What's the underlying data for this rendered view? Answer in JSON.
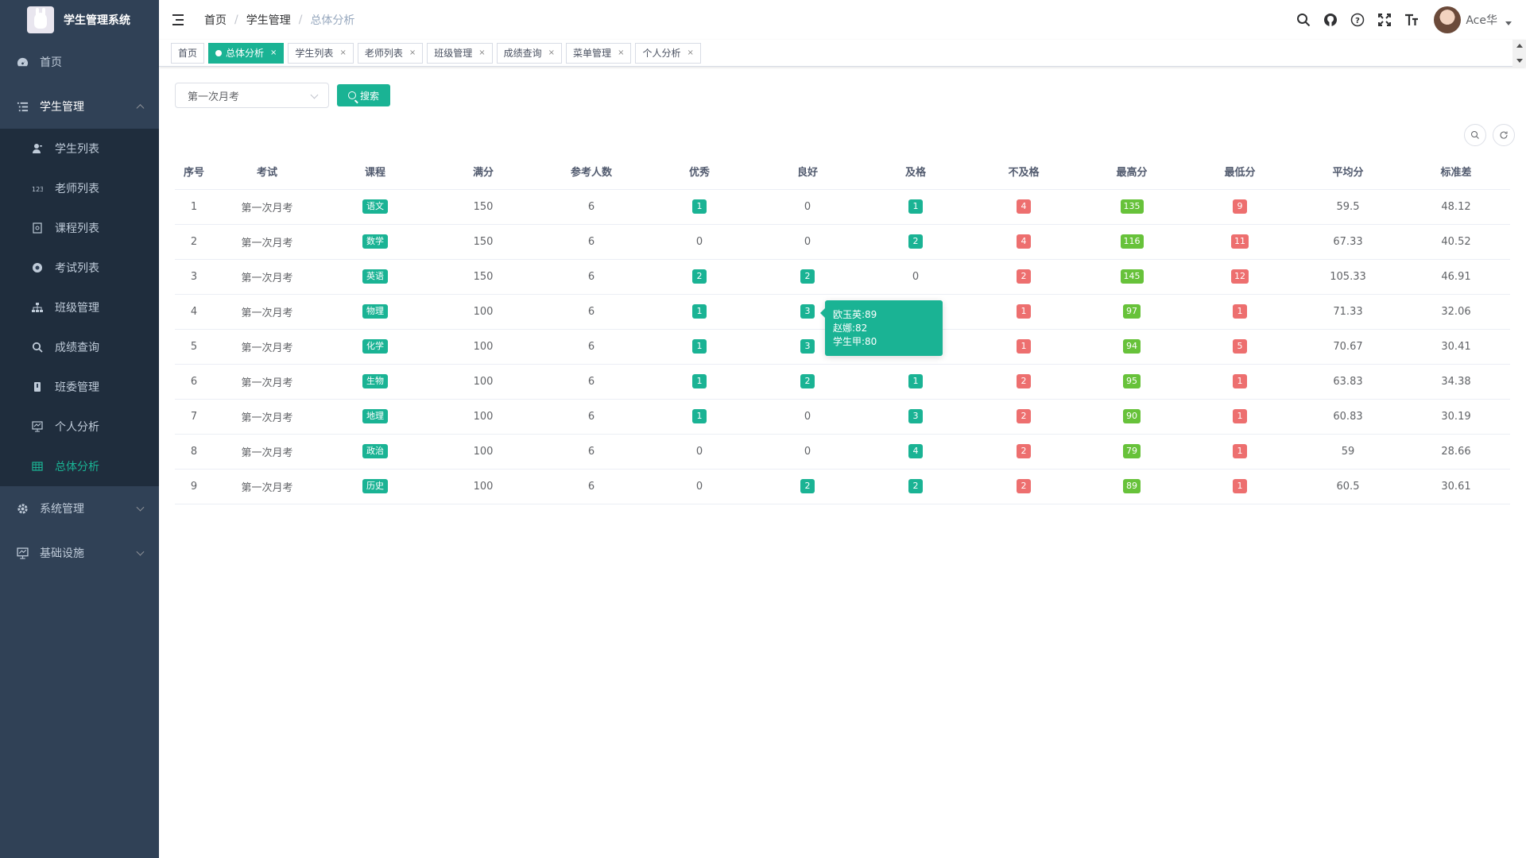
{
  "app": {
    "title": "学生管理系统"
  },
  "sidebar": {
    "items": [
      {
        "label": "首页",
        "icon": "dashboard-icon"
      },
      {
        "label": "学生管理",
        "icon": "list-icon",
        "open": true,
        "children": [
          {
            "label": "学生列表",
            "icon": "user-icon"
          },
          {
            "label": "老师列表",
            "icon": "number-icon"
          },
          {
            "label": "课程列表",
            "icon": "book-icon"
          },
          {
            "label": "考试列表",
            "icon": "exam-icon"
          },
          {
            "label": "班级管理",
            "icon": "tree-icon"
          },
          {
            "label": "成绩查询",
            "icon": "search-icon"
          },
          {
            "label": "班委管理",
            "icon": "badge-icon"
          },
          {
            "label": "个人分析",
            "icon": "monitor-icon"
          },
          {
            "label": "总体分析",
            "icon": "table-icon",
            "active": true
          }
        ]
      },
      {
        "label": "系统管理",
        "icon": "gear-icon"
      },
      {
        "label": "基础设施",
        "icon": "monitor-icon"
      }
    ]
  },
  "navbar": {
    "breadcrumb": [
      "首页",
      "学生管理",
      "总体分析"
    ],
    "user_name": "Ace华"
  },
  "tags": [
    {
      "label": "首页",
      "active": false,
      "closable": false
    },
    {
      "label": "总体分析",
      "active": true,
      "closable": true
    },
    {
      "label": "学生列表",
      "active": false,
      "closable": true
    },
    {
      "label": "老师列表",
      "active": false,
      "closable": true
    },
    {
      "label": "班级管理",
      "active": false,
      "closable": true
    },
    {
      "label": "成绩查询",
      "active": false,
      "closable": true
    },
    {
      "label": "菜单管理",
      "active": false,
      "closable": true
    },
    {
      "label": "个人分析",
      "active": false,
      "closable": true
    }
  ],
  "search": {
    "exam_value": "第一次月考",
    "button_label": "搜索"
  },
  "table": {
    "headers": [
      "序号",
      "考试",
      "课程",
      "满分",
      "参考人数",
      "优秀",
      "良好",
      "及格",
      "不及格",
      "最高分",
      "最低分",
      "平均分",
      "标准差"
    ],
    "rows": [
      [
        "1",
        "第一次月考",
        "语文",
        "150",
        "6",
        "1",
        "0",
        "1",
        "4",
        "135",
        "9",
        "59.5",
        "48.12"
      ],
      [
        "2",
        "第一次月考",
        "数学",
        "150",
        "6",
        "0",
        "0",
        "2",
        "4",
        "116",
        "11",
        "67.33",
        "40.52"
      ],
      [
        "3",
        "第一次月考",
        "英语",
        "150",
        "6",
        "2",
        "2",
        "0",
        "2",
        "145",
        "12",
        "105.33",
        "46.91"
      ],
      [
        "4",
        "第一次月考",
        "物理",
        "100",
        "6",
        "1",
        "3",
        "",
        "1",
        "97",
        "1",
        "71.33",
        "32.06"
      ],
      [
        "5",
        "第一次月考",
        "化学",
        "100",
        "6",
        "1",
        "3",
        "",
        "1",
        "94",
        "5",
        "70.67",
        "30.41"
      ],
      [
        "6",
        "第一次月考",
        "生物",
        "100",
        "6",
        "1",
        "2",
        "1",
        "2",
        "95",
        "1",
        "63.83",
        "34.38"
      ],
      [
        "7",
        "第一次月考",
        "地理",
        "100",
        "6",
        "1",
        "0",
        "3",
        "2",
        "90",
        "1",
        "60.83",
        "30.19"
      ],
      [
        "8",
        "第一次月考",
        "政治",
        "100",
        "6",
        "0",
        "0",
        "4",
        "2",
        "79",
        "1",
        "59",
        "28.66"
      ],
      [
        "9",
        "第一次月考",
        "历史",
        "100",
        "6",
        "0",
        "2",
        "2",
        "2",
        "89",
        "1",
        "60.5",
        "30.61"
      ]
    ]
  },
  "tooltip": {
    "lines": [
      "欧玉英:89",
      "赵娜:82",
      "学生甲:80"
    ]
  },
  "colors": {
    "accent": "#1ab394",
    "danger": "#ed6f6f",
    "success": "#67c23a",
    "sidebar": "#304156",
    "submenu": "#1f2d3d"
  }
}
